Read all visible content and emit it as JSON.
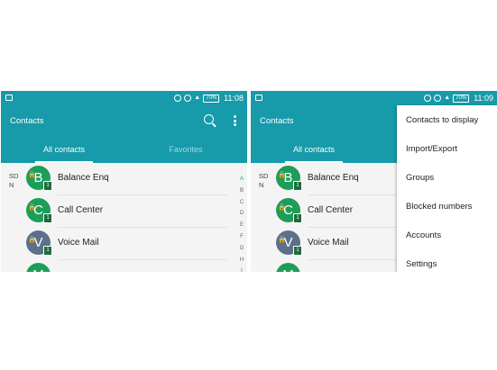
{
  "colors": {
    "primary": "#179aa9",
    "avatar_green": "#1e9d58",
    "avatar_slate": "#5d6f8a",
    "sim_badge": "#1e6b3b"
  },
  "left": {
    "status": {
      "time": "11:08",
      "battery": "70%"
    },
    "appbar": {
      "title": "Contacts",
      "tabs": [
        "All contacts",
        "Favorites"
      ]
    },
    "section_letters": "SD\nN",
    "contacts": [
      {
        "initial": "B",
        "name": "Balance Enq",
        "color": "#1e9d58",
        "locked": true,
        "sim": "1"
      },
      {
        "initial": "C",
        "name": "Call Center",
        "color": "#1e9d58",
        "locked": true,
        "sim": "1"
      },
      {
        "initial": "V",
        "name": "Voice Mail",
        "color": "#5d6f8a",
        "locked": true,
        "sim": "1"
      },
      {
        "initial": "M",
        "name": "",
        "color": "#1e9d58",
        "locked": false,
        "sim": ""
      }
    ],
    "index": [
      "A",
      "B",
      "C",
      "D",
      "E",
      "F",
      "G",
      "H",
      "I"
    ]
  },
  "right": {
    "status": {
      "time": "11:09",
      "battery": "70%"
    },
    "appbar": {
      "title": "Contacts",
      "tabs": [
        "All contacts"
      ]
    },
    "section_letters": "SD\nN",
    "contacts": [
      {
        "initial": "B",
        "name": "Balance Enq",
        "color": "#1e9d58",
        "locked": true,
        "sim": "1"
      },
      {
        "initial": "C",
        "name": "Call Center",
        "color": "#1e9d58",
        "locked": true,
        "sim": "1"
      },
      {
        "initial": "V",
        "name": "Voice Mail",
        "color": "#5d6f8a",
        "locked": true,
        "sim": "1"
      },
      {
        "initial": "M",
        "name": "",
        "color": "#1e9d58",
        "locked": false,
        "sim": ""
      }
    ],
    "menu": [
      "Contacts to display",
      "Import/Export",
      "Groups",
      "Blocked numbers",
      "Accounts",
      "Settings"
    ]
  }
}
